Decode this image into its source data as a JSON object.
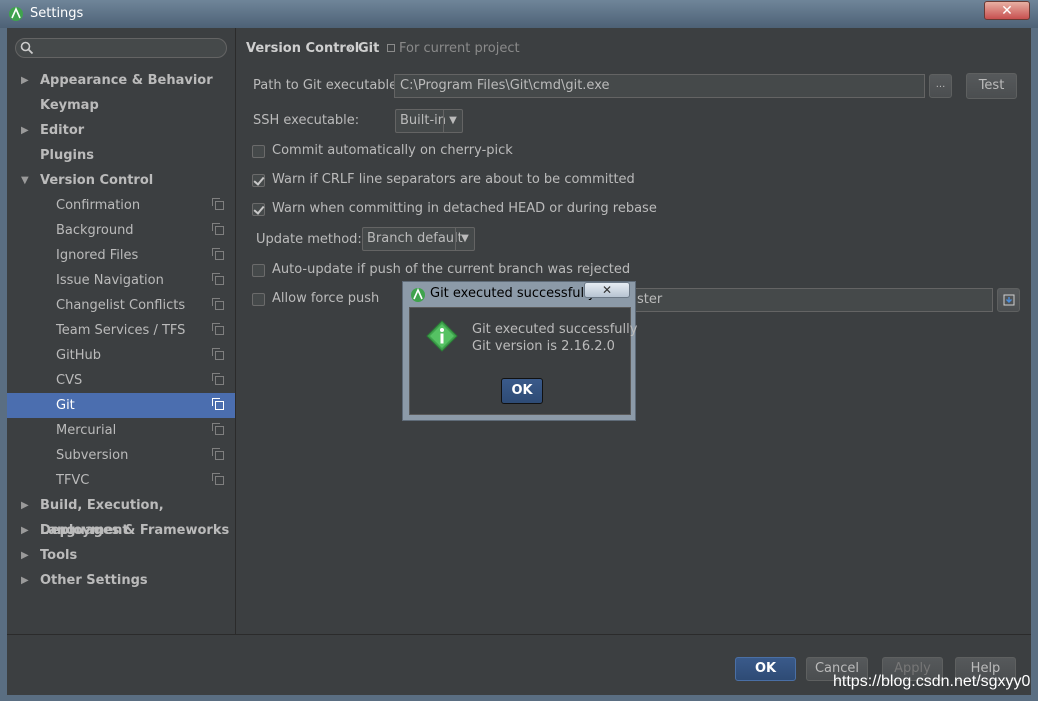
{
  "window": {
    "title": "Settings",
    "close_label": "✕"
  },
  "search": {
    "placeholder": ""
  },
  "sidebar": {
    "items": [
      {
        "label": "Appearance & Behavior",
        "arrow": "▶",
        "level": 0
      },
      {
        "label": "Keymap",
        "arrow": "",
        "level": 0
      },
      {
        "label": "Editor",
        "arrow": "▶",
        "level": 0
      },
      {
        "label": "Plugins",
        "arrow": "",
        "level": 0
      },
      {
        "label": "Version Control",
        "arrow": "▼",
        "level": 0
      },
      {
        "label": "Confirmation",
        "level": 1
      },
      {
        "label": "Background",
        "level": 1
      },
      {
        "label": "Ignored Files",
        "level": 1
      },
      {
        "label": "Issue Navigation",
        "level": 1
      },
      {
        "label": "Changelist Conflicts",
        "level": 1
      },
      {
        "label": "Team Services / TFS",
        "level": 1
      },
      {
        "label": "GitHub",
        "level": 1
      },
      {
        "label": "CVS",
        "level": 1
      },
      {
        "label": "Git",
        "level": 1,
        "selected": true
      },
      {
        "label": "Mercurial",
        "level": 1
      },
      {
        "label": "Subversion",
        "level": 1
      },
      {
        "label": "TFVC",
        "level": 1
      },
      {
        "label": "Build, Execution, Deployment",
        "arrow": "▶",
        "level": 0
      },
      {
        "label": "Languages & Frameworks",
        "arrow": "▶",
        "level": 0
      },
      {
        "label": "Tools",
        "arrow": "▶",
        "level": 0
      },
      {
        "label": "Other Settings",
        "arrow": "▶",
        "level": 0
      }
    ]
  },
  "breadcrumb": {
    "part1": "Version Control",
    "sep": "›",
    "part2": "Git",
    "scope": "For current project"
  },
  "git": {
    "path_label": "Path to Git executable:",
    "path_value": "C:\\Program Files\\Git\\cmd\\git.exe",
    "browse_label": "...",
    "test_label": "Test",
    "ssh_label": "SSH executable:",
    "ssh_value": "Built-in",
    "cherry_pick_label": "Commit automatically on cherry-pick",
    "crlf_label": "Warn if CRLF line separators are about to be committed",
    "detached_label": "Warn when committing in detached HEAD or during rebase",
    "update_method_label": "Update method:",
    "update_method_value": "Branch default",
    "auto_update_label": "Auto-update if push of the current branch was rejected",
    "force_push_label": "Allow force push",
    "protected_value": "ster"
  },
  "checkboxes": {
    "cherry_pick": false,
    "crlf": true,
    "detached": true,
    "auto_update": false,
    "force_push": false
  },
  "dialog": {
    "title": "Git executed successfully",
    "close_label": "✕",
    "message_line1": "Git executed successfully",
    "message_line2": "Git version is 2.16.2.0",
    "ok_label": "OK",
    "icon": "info-diamond-icon"
  },
  "footer": {
    "ok_label": "OK",
    "cancel_label": "Cancel",
    "apply_label": "Apply",
    "help_label": "Help"
  },
  "watermark": "https://blog.csdn.net/sgxyy0",
  "colors": {
    "background": "#3c3f41",
    "selection": "#4b6eaf",
    "titlebar": "#5a6e82",
    "accent_green": "#3fa34d"
  }
}
